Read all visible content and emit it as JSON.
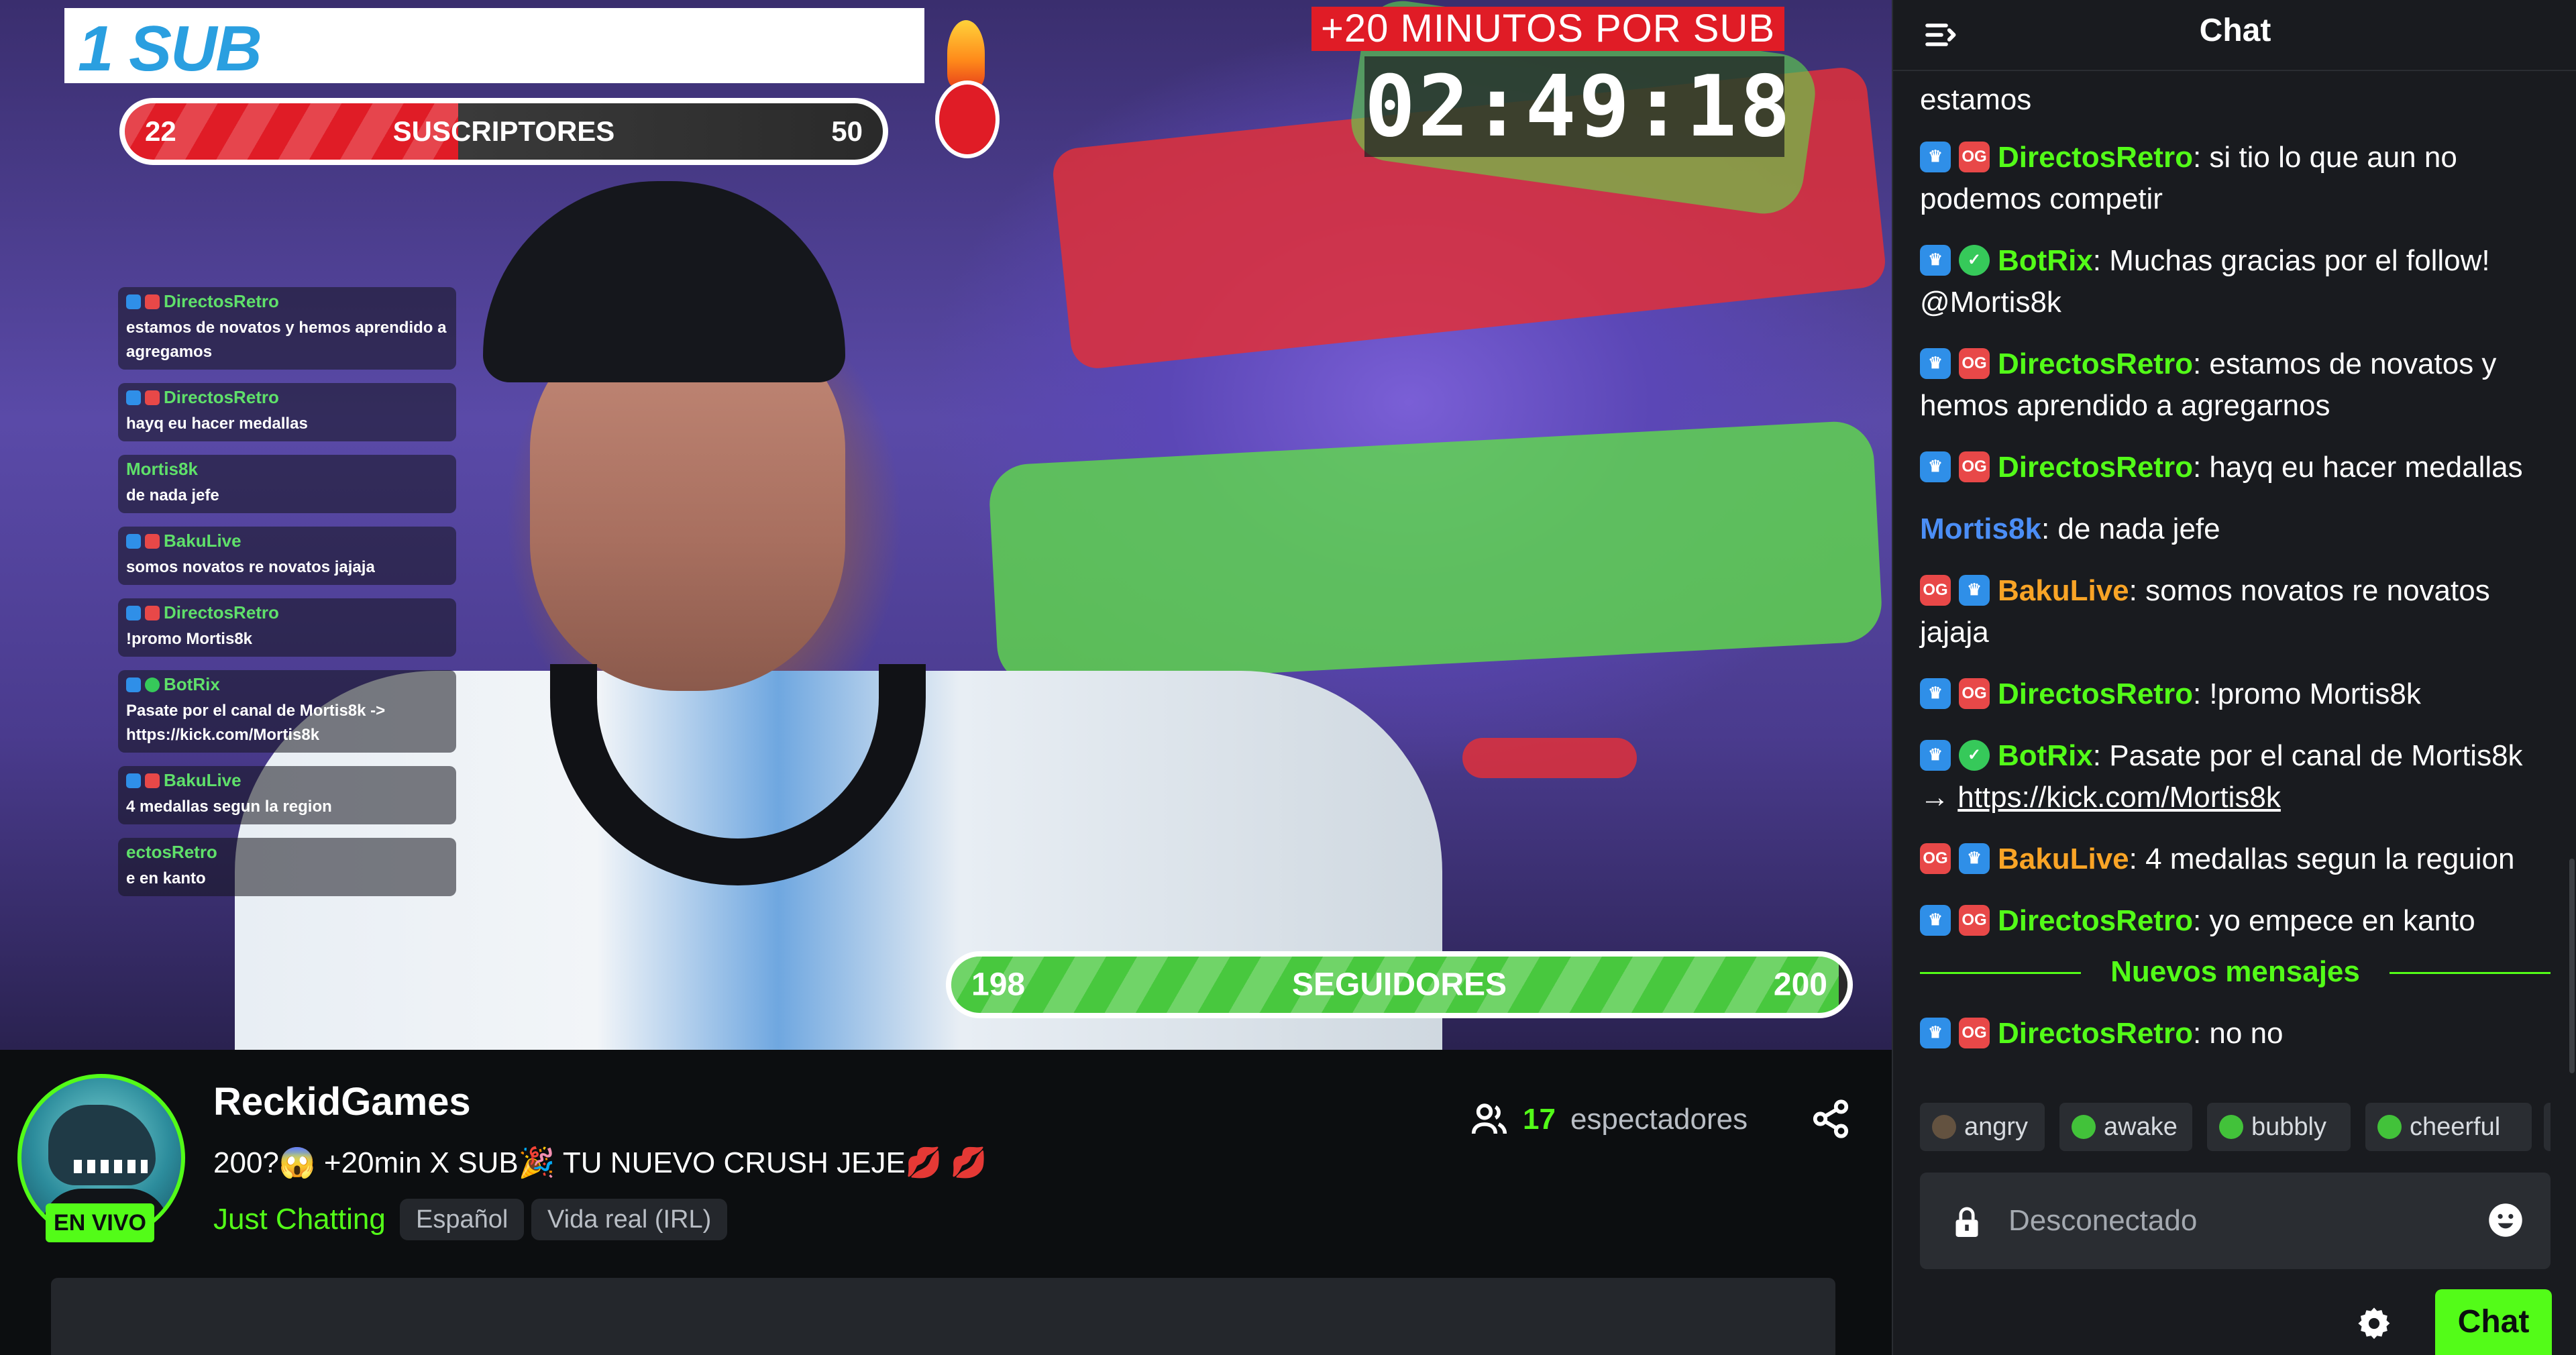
{
  "stream_overlay": {
    "sub_goal_title": "1 SUB",
    "subs_bar": {
      "current": "22",
      "label": "SUSCRIPTORES",
      "target": "50",
      "progress": 0.44
    },
    "timer_caption": "+20 MINUTOS POR SUB",
    "timer_value": "02:49:18",
    "followers_bar": {
      "current": "198",
      "label": "SEGUIDORES",
      "target": "200",
      "progress": 0.99
    },
    "chat_messages": [
      {
        "user": "DirectosRetro",
        "text": "estamos de novatos y hemos aprendido a agregamos"
      },
      {
        "user": "DirectosRetro",
        "text": "hayq eu hacer medallas"
      },
      {
        "user": "Mortis8k",
        "text": "de nada jefe"
      },
      {
        "user": "BakuLive",
        "text": "somos novatos re novatos jajaja"
      },
      {
        "user": "DirectosRetro",
        "text": "!promo Mortis8k"
      },
      {
        "user": "BotRix",
        "text": "Pasate por el canal de Mortis8k -> https://kick.com/Mortis8k"
      },
      {
        "user": "BakuLive",
        "text": "4 medallas segun la region"
      },
      {
        "user": "ectosRetro",
        "text": "e en kanto"
      }
    ]
  },
  "channel": {
    "live_label": "EN VIVO",
    "name": "ReckidGames",
    "title": "200?😱 +20min X SUB🎉 TU NUEVO CRUSH JEJE💋 💋",
    "category": "Just Chatting",
    "tags": [
      "Español",
      "Vida real (IRL)"
    ],
    "viewers_count": "17",
    "viewers_label": "espectadores"
  },
  "chat": {
    "title": "Chat",
    "messages": [
      {
        "text": "estamos"
      },
      {
        "badges": [
          "blue",
          "og"
        ],
        "user": "DirectosRetro",
        "user_color": "green",
        "text": "si tio lo que aun no podemos competir"
      },
      {
        "badges": [
          "blue",
          "verified"
        ],
        "user": "BotRix",
        "user_color": "green",
        "text": "Muchas gracias por el follow! @Mortis8k"
      },
      {
        "badges": [
          "blue",
          "og"
        ],
        "user": "DirectosRetro",
        "user_color": "green",
        "text": "estamos de novatos y hemos aprendido a agregarnos"
      },
      {
        "badges": [
          "blue",
          "og"
        ],
        "user": "DirectosRetro",
        "user_color": "green",
        "text": "hayq eu hacer medallas"
      },
      {
        "badges": [],
        "user": "Mortis8k",
        "user_color": "blue",
        "text": "de nada jefe"
      },
      {
        "badges": [
          "og",
          "blue"
        ],
        "user": "BakuLive",
        "user_color": "orange",
        "text": "somos novatos re novatos jajaja"
      },
      {
        "badges": [
          "blue",
          "og"
        ],
        "user": "DirectosRetro",
        "user_color": "green",
        "text": "!promo Mortis8k"
      },
      {
        "badges": [
          "blue",
          "verified"
        ],
        "user": "BotRix",
        "user_color": "green",
        "text": "Pasate por el canal de Mortis8k →",
        "link": "https://kick.com/Mortis8k"
      },
      {
        "badges": [
          "og",
          "blue"
        ],
        "user": "BakuLive",
        "user_color": "orange",
        "text": "4 medallas segun la reguion"
      },
      {
        "badges": [
          "blue",
          "og"
        ],
        "user": "DirectosRetro",
        "user_color": "green",
        "text": "yo empece en kanto"
      },
      {
        "badges": [
          "blue",
          "og"
        ],
        "user": "DirectosRetro",
        "user_color": "green",
        "text": "no no"
      }
    ],
    "new_messages_label": "Nuevos mensajes",
    "emotes": [
      "angry",
      "awake",
      "bubbly",
      "cheerful"
    ],
    "input_placeholder": "Desconectado",
    "send_label": "Chat"
  },
  "colors": {
    "brand_green": "#53fc18",
    "user_green": "#53fc18",
    "user_blue": "#4b8ef6",
    "user_orange": "#f9a426",
    "subs_red": "#e01c26"
  }
}
